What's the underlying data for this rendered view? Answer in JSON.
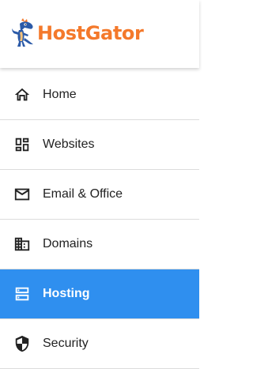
{
  "brand": {
    "name": "HostGator",
    "color": "#f4792b"
  },
  "accent": "#2f8fef",
  "nav": {
    "items": [
      {
        "label": "Home",
        "icon": "home-icon",
        "active": false
      },
      {
        "label": "Websites",
        "icon": "dashboard-icon",
        "active": false
      },
      {
        "label": "Email & Office",
        "icon": "mail-icon",
        "active": false
      },
      {
        "label": "Domains",
        "icon": "building-icon",
        "active": false
      },
      {
        "label": "Hosting",
        "icon": "server-icon",
        "active": true
      },
      {
        "label": "Security",
        "icon": "shield-icon",
        "active": false
      }
    ]
  }
}
